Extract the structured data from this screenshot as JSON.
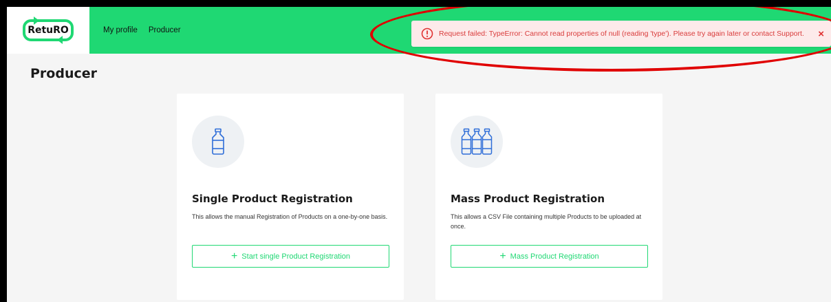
{
  "app": {
    "logo_text": "RetuRO"
  },
  "nav": {
    "items": [
      "My profile",
      "Producer"
    ]
  },
  "toast": {
    "message": "Request failed: TypeError: Cannot read properties of null (reading 'type'). Please try again later or contact Support.",
    "close_icon": "×",
    "color": "#d93b3b"
  },
  "page": {
    "title": "Producer"
  },
  "cards": [
    {
      "icon": "bottle-icon",
      "title": "Single Product Registration",
      "description": "This allows the manual Registration of Products on a one-by-one basis.",
      "button_label": "Start single Product Registration"
    },
    {
      "icon": "bottles-icon",
      "title": "Mass Product Registration",
      "description": "This allows a CSV File containing multiple Products to be uploaded at once.",
      "button_label": "Mass Product Registration"
    }
  ],
  "colors": {
    "accent": "#1fd873",
    "highlight": "#e00000",
    "background": "#f5f5f5"
  }
}
